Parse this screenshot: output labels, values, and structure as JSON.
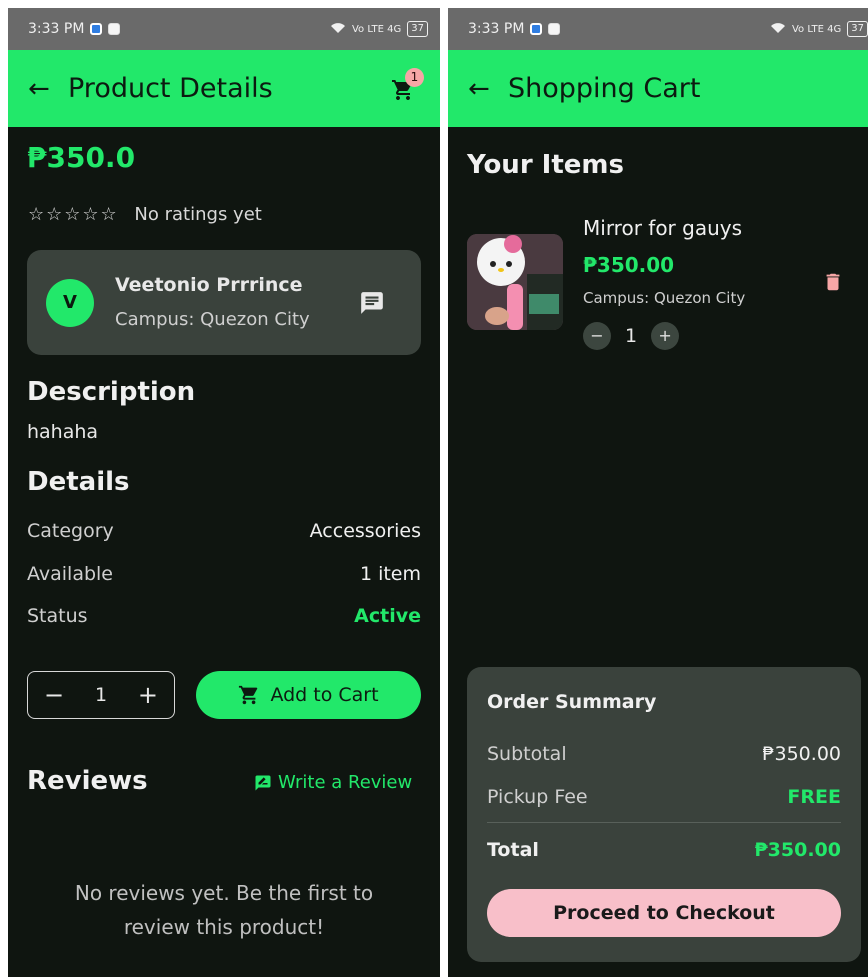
{
  "colors": {
    "accent": "#22e86a",
    "card": "#3a423c",
    "background": "#0f1510",
    "checkout": "#f8bfc9",
    "trash": "#f7a6a6"
  },
  "left": {
    "status": {
      "time": "3:33 PM",
      "network": "Vo LTE 4G",
      "battery": "37"
    },
    "appbar": {
      "back_icon": "arrow-left-icon",
      "title": "Product Details",
      "cart_icon": "cart-icon",
      "cart_badge": "1"
    },
    "price": "₱350.0",
    "rating": {
      "stars": "☆☆☆☆☆",
      "text": "No ratings yet"
    },
    "seller": {
      "avatar_letter": "V",
      "name": "Veetonio Prrrince",
      "campus": "Campus: Quezon City",
      "chat_icon": "chat-icon"
    },
    "description": {
      "heading": "Description",
      "text": "hahaha"
    },
    "details": {
      "heading": "Details",
      "rows": [
        {
          "label": "Category",
          "value": "Accessories"
        },
        {
          "label": "Available",
          "value": "1 item"
        },
        {
          "label": "Status",
          "value": "Active"
        }
      ]
    },
    "quantity": {
      "minus": "−",
      "value": "1",
      "plus": "+"
    },
    "add_to_cart": "Add to Cart",
    "reviews": {
      "heading": "Reviews",
      "write": "Write a Review",
      "empty_line1": "No reviews yet. Be the first to",
      "empty_line2": "review this product!"
    }
  },
  "right": {
    "status": {
      "time": "3:33 PM",
      "network": "Vo LTE 4G",
      "battery": "37"
    },
    "appbar": {
      "back_icon": "arrow-left-icon",
      "title": "Shopping Cart"
    },
    "heading": "Your Items",
    "item": {
      "name": "Mirror for gauys",
      "price": "₱350.00",
      "campus": "Campus: Quezon City",
      "qty": "1",
      "minus": "−",
      "plus": "+"
    },
    "summary": {
      "title": "Order Summary",
      "subtotal_label": "Subtotal",
      "subtotal_value": "₱350.00",
      "fee_label": "Pickup Fee",
      "fee_value": "FREE",
      "total_label": "Total",
      "total_value": "₱350.00",
      "checkout": "Proceed to Checkout"
    }
  }
}
